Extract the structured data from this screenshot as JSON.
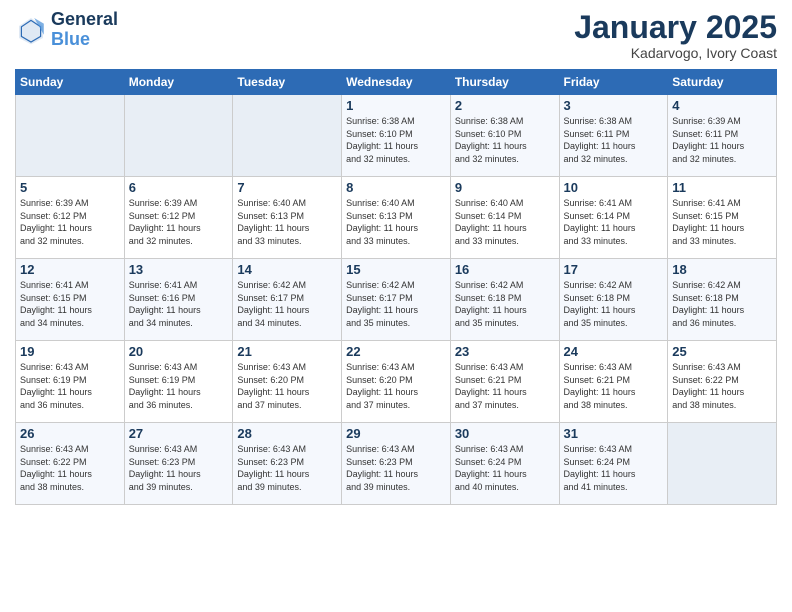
{
  "logo": {
    "line1": "General",
    "line2": "Blue"
  },
  "title": "January 2025",
  "location": "Kadarvogo, Ivory Coast",
  "days_of_week": [
    "Sunday",
    "Monday",
    "Tuesday",
    "Wednesday",
    "Thursday",
    "Friday",
    "Saturday"
  ],
  "weeks": [
    [
      {
        "day": "",
        "info": ""
      },
      {
        "day": "",
        "info": ""
      },
      {
        "day": "",
        "info": ""
      },
      {
        "day": "1",
        "info": "Sunrise: 6:38 AM\nSunset: 6:10 PM\nDaylight: 11 hours\nand 32 minutes."
      },
      {
        "day": "2",
        "info": "Sunrise: 6:38 AM\nSunset: 6:10 PM\nDaylight: 11 hours\nand 32 minutes."
      },
      {
        "day": "3",
        "info": "Sunrise: 6:38 AM\nSunset: 6:11 PM\nDaylight: 11 hours\nand 32 minutes."
      },
      {
        "day": "4",
        "info": "Sunrise: 6:39 AM\nSunset: 6:11 PM\nDaylight: 11 hours\nand 32 minutes."
      }
    ],
    [
      {
        "day": "5",
        "info": "Sunrise: 6:39 AM\nSunset: 6:12 PM\nDaylight: 11 hours\nand 32 minutes."
      },
      {
        "day": "6",
        "info": "Sunrise: 6:39 AM\nSunset: 6:12 PM\nDaylight: 11 hours\nand 32 minutes."
      },
      {
        "day": "7",
        "info": "Sunrise: 6:40 AM\nSunset: 6:13 PM\nDaylight: 11 hours\nand 33 minutes."
      },
      {
        "day": "8",
        "info": "Sunrise: 6:40 AM\nSunset: 6:13 PM\nDaylight: 11 hours\nand 33 minutes."
      },
      {
        "day": "9",
        "info": "Sunrise: 6:40 AM\nSunset: 6:14 PM\nDaylight: 11 hours\nand 33 minutes."
      },
      {
        "day": "10",
        "info": "Sunrise: 6:41 AM\nSunset: 6:14 PM\nDaylight: 11 hours\nand 33 minutes."
      },
      {
        "day": "11",
        "info": "Sunrise: 6:41 AM\nSunset: 6:15 PM\nDaylight: 11 hours\nand 33 minutes."
      }
    ],
    [
      {
        "day": "12",
        "info": "Sunrise: 6:41 AM\nSunset: 6:15 PM\nDaylight: 11 hours\nand 34 minutes."
      },
      {
        "day": "13",
        "info": "Sunrise: 6:41 AM\nSunset: 6:16 PM\nDaylight: 11 hours\nand 34 minutes."
      },
      {
        "day": "14",
        "info": "Sunrise: 6:42 AM\nSunset: 6:17 PM\nDaylight: 11 hours\nand 34 minutes."
      },
      {
        "day": "15",
        "info": "Sunrise: 6:42 AM\nSunset: 6:17 PM\nDaylight: 11 hours\nand 35 minutes."
      },
      {
        "day": "16",
        "info": "Sunrise: 6:42 AM\nSunset: 6:18 PM\nDaylight: 11 hours\nand 35 minutes."
      },
      {
        "day": "17",
        "info": "Sunrise: 6:42 AM\nSunset: 6:18 PM\nDaylight: 11 hours\nand 35 minutes."
      },
      {
        "day": "18",
        "info": "Sunrise: 6:42 AM\nSunset: 6:18 PM\nDaylight: 11 hours\nand 36 minutes."
      }
    ],
    [
      {
        "day": "19",
        "info": "Sunrise: 6:43 AM\nSunset: 6:19 PM\nDaylight: 11 hours\nand 36 minutes."
      },
      {
        "day": "20",
        "info": "Sunrise: 6:43 AM\nSunset: 6:19 PM\nDaylight: 11 hours\nand 36 minutes."
      },
      {
        "day": "21",
        "info": "Sunrise: 6:43 AM\nSunset: 6:20 PM\nDaylight: 11 hours\nand 37 minutes."
      },
      {
        "day": "22",
        "info": "Sunrise: 6:43 AM\nSunset: 6:20 PM\nDaylight: 11 hours\nand 37 minutes."
      },
      {
        "day": "23",
        "info": "Sunrise: 6:43 AM\nSunset: 6:21 PM\nDaylight: 11 hours\nand 37 minutes."
      },
      {
        "day": "24",
        "info": "Sunrise: 6:43 AM\nSunset: 6:21 PM\nDaylight: 11 hours\nand 38 minutes."
      },
      {
        "day": "25",
        "info": "Sunrise: 6:43 AM\nSunset: 6:22 PM\nDaylight: 11 hours\nand 38 minutes."
      }
    ],
    [
      {
        "day": "26",
        "info": "Sunrise: 6:43 AM\nSunset: 6:22 PM\nDaylight: 11 hours\nand 38 minutes."
      },
      {
        "day": "27",
        "info": "Sunrise: 6:43 AM\nSunset: 6:23 PM\nDaylight: 11 hours\nand 39 minutes."
      },
      {
        "day": "28",
        "info": "Sunrise: 6:43 AM\nSunset: 6:23 PM\nDaylight: 11 hours\nand 39 minutes."
      },
      {
        "day": "29",
        "info": "Sunrise: 6:43 AM\nSunset: 6:23 PM\nDaylight: 11 hours\nand 39 minutes."
      },
      {
        "day": "30",
        "info": "Sunrise: 6:43 AM\nSunset: 6:24 PM\nDaylight: 11 hours\nand 40 minutes."
      },
      {
        "day": "31",
        "info": "Sunrise: 6:43 AM\nSunset: 6:24 PM\nDaylight: 11 hours\nand 41 minutes."
      },
      {
        "day": "",
        "info": ""
      }
    ]
  ]
}
